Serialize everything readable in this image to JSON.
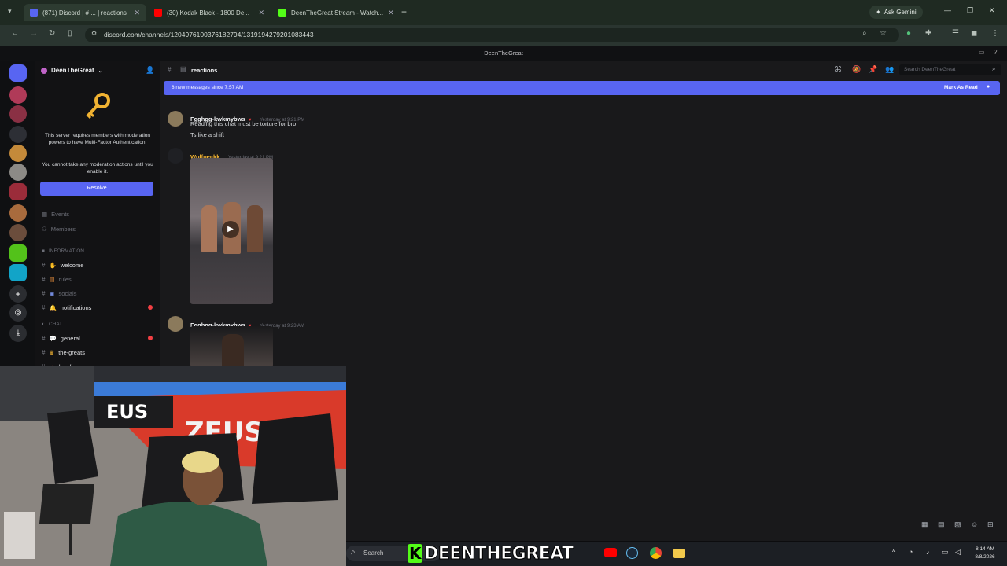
{
  "browser": {
    "tabs": [
      {
        "label": "(871) Discord | # ... | reactions",
        "color": "#5865f2"
      },
      {
        "label": "(30) Kodak Black - 1800 De...",
        "color": "#ff0000"
      },
      {
        "label": "DeenTheGreat Stream - Watch...",
        "color": "#53fc18"
      }
    ],
    "ask_gemini": "Ask Gemini",
    "url": "discord.com/channels/1204976100376182794/1319194279201083443",
    "window_title": "DeenTheGreat"
  },
  "discord": {
    "server_name": "DeenTheGreat",
    "mfa_notice": "This server requires members with moderation powers to have Multi-Factor Authentication.",
    "mfa_sub": "You cannot take any moderation actions until you enable it.",
    "resolve_label": "Resolve",
    "events_label": "Events",
    "members_label": "Members",
    "category_info": "INFORMATION",
    "category_chat": "CHAT",
    "channels": [
      {
        "name": "welcome",
        "dim": false
      },
      {
        "name": "rules",
        "dim": true
      },
      {
        "name": "socials",
        "dim": true
      },
      {
        "name": "notifications",
        "dim": false
      }
    ],
    "chat_channels": [
      {
        "name": "general"
      },
      {
        "name": "the-greats"
      },
      {
        "name": "leveling"
      }
    ],
    "current_channel": "reactions",
    "search_placeholder": "Search DeenTheGreat",
    "new_messages_banner": "8 new messages since 7:57 AM",
    "mark_as_read": "Mark As Read",
    "messages": [
      {
        "author": "Fgghgg-kwkmybws",
        "time": "Yesterday at 9:21 PM",
        "lines": [
          "Reading this chat must be torture for bro",
          "Ts like a shift"
        ]
      },
      {
        "author": "Wolfpeckk",
        "time": "Yesterday at 9:21 PM",
        "lines": []
      },
      {
        "author": "Fgghgg-kwkmybws",
        "time": "Yesterday at 9:23 AM",
        "lines": []
      }
    ]
  },
  "taskbar": {
    "search_label": "Search",
    "watermark": "DEENTHEGREAT",
    "watermark_k": "K",
    "time": "8:14 AM",
    "date": "8/8/2026"
  }
}
